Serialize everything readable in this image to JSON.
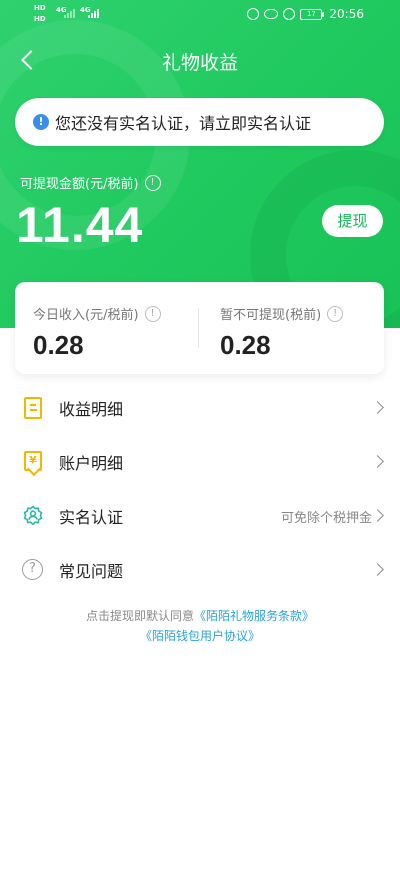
{
  "status_bar": {
    "net_left_1": "HD",
    "net_left_2": "HD",
    "sig1": "4G",
    "sig2": "4G",
    "battery": "17",
    "time": "20:56"
  },
  "nav": {
    "title": "礼物收益"
  },
  "notice": {
    "text": "您还没有实名认证，请立即实名认证",
    "icon": "info-icon"
  },
  "balance": {
    "label": "可提现金额(元/税前)",
    "amount": "11.44",
    "withdraw_label": "提现"
  },
  "summary": {
    "today_label": "今日收入(元/税前)",
    "today_value": "0.28",
    "pending_label": "暂不可提现(税前)",
    "pending_value": "0.28"
  },
  "menu": [
    {
      "label": "收益明细",
      "extra": "",
      "icon": "document-icon"
    },
    {
      "label": "账户明细",
      "extra": "",
      "icon": "yen-receipt-icon"
    },
    {
      "label": "实名认证",
      "extra": "可免除个税押金",
      "icon": "verified-user-icon"
    },
    {
      "label": "常见问题",
      "extra": "",
      "icon": "help-circle-icon"
    }
  ],
  "agreement": {
    "prefix": "点击提现即默认同意",
    "link1": "《陌陌礼物服务条款》",
    "link2": "《陌陌钱包用户协议》"
  },
  "colors": {
    "brand_green": "#1fc95e",
    "link_blue": "#2aa3d6",
    "icon_yellow": "#f0b800",
    "icon_teal": "#2bb7b0"
  }
}
